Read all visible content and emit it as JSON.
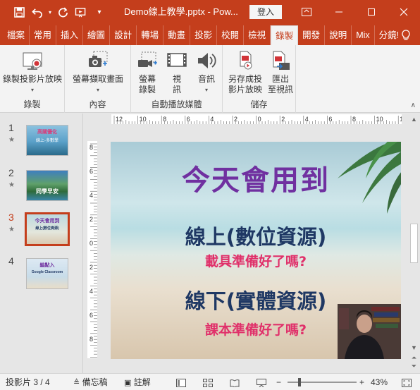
{
  "titlebar": {
    "doc_title": "Demo線上教學.pptx - Pow...",
    "signin_label": "登入",
    "icons": [
      "save-icon",
      "undo-icon",
      "redo-icon",
      "present-icon",
      "customize-icon"
    ],
    "window_controls": [
      "ribbon-display-icon",
      "minimize-icon",
      "restore-icon",
      "close-icon"
    ]
  },
  "tabs": [
    "檔案",
    "常用",
    "插入",
    "繪圖",
    "設計",
    "轉場",
    "動畫",
    "投影",
    "校閱",
    "檢視",
    "錄製",
    "開發",
    "說明",
    "Mix",
    "分鏡!"
  ],
  "active_tab": "錄製",
  "tell_me_icon": "lightbulb-icon",
  "ribbon": {
    "groups": [
      {
        "label": "錄製",
        "buttons": [
          {
            "label_line1": "錄製投影片放映",
            "label_line2": "",
            "icon": "record-slideshow-icon"
          }
        ]
      },
      {
        "label": "內容",
        "buttons": [
          {
            "label_line1": "螢幕擷取畫面",
            "label_line2": "",
            "icon": "screenshot-camera-icon"
          }
        ]
      },
      {
        "label": "自動播放媒體",
        "buttons": [
          {
            "label_line1": "螢幕",
            "label_line2": "錄製",
            "icon": "screen-recording-icon"
          },
          {
            "label_line1": "視",
            "label_line2": "訊",
            "icon": "video-icon"
          },
          {
            "label_line1": "音訊",
            "label_line2": "",
            "icon": "audio-icon"
          }
        ]
      },
      {
        "label": "儲存",
        "buttons": [
          {
            "label_line1": "另存成投",
            "label_line2": "影片放映",
            "icon": "save-as-show-icon"
          },
          {
            "label_line1": "匯出",
            "label_line2": "至視訊",
            "icon": "export-video-icon"
          }
        ]
      }
    ]
  },
  "thumbnails": [
    {
      "number": "1",
      "star": "★",
      "caption": "高關優化",
      "caption2": "線上-多數學",
      "active": false
    },
    {
      "number": "2",
      "star": "★",
      "caption": "同學早安",
      "caption2": "",
      "active": false
    },
    {
      "number": "3",
      "star": "★",
      "caption": "今天會用到",
      "caption2": "線上(數位資源)",
      "active": true
    },
    {
      "number": "4",
      "star": "",
      "caption": "編點入",
      "caption2": "Google Classroom",
      "active": false
    }
  ],
  "slide": {
    "title": "今天會用到",
    "heading1": "線上(數位資源)",
    "sub1": "載具準備好了嗎?",
    "heading2": "線下(實體資源)",
    "sub2": "課本準備好了嗎?"
  },
  "statusbar": {
    "slide_indicator": "投影片 3 / 4",
    "notes_label": "備忘稿",
    "comments_label": "註解",
    "zoom_minus": "−",
    "zoom_plus": "+",
    "zoom_level": "43%",
    "zoom_fraction": 0.43
  }
}
